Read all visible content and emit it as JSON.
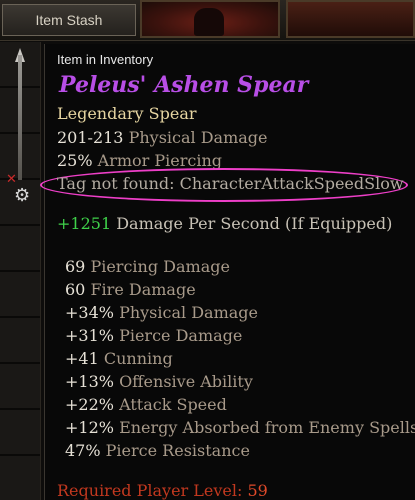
{
  "stash": {
    "tab_label": "Item Stash"
  },
  "tooltip": {
    "location": "Item in Inventory",
    "item_name": "Peleus' Ashen Spear",
    "item_type": "Legendary Spear",
    "base_stats": [
      {
        "value": "201-213",
        "label": "Physical Damage"
      },
      {
        "value": "25%",
        "label": "Armor Piercing"
      }
    ],
    "tag_error": "Tag not found: CharacterAttackSpeedSlow",
    "dps": {
      "value": "+1251",
      "label": "Damage Per Second (If Equipped)"
    },
    "mods": [
      {
        "value": "69",
        "label": "Piercing Damage"
      },
      {
        "value": "60",
        "label": "Fire Damage"
      },
      {
        "value": "+34%",
        "label": "Physical Damage"
      },
      {
        "value": "+31%",
        "label": "Pierce Damage"
      },
      {
        "value": "+41",
        "label": "Cunning"
      },
      {
        "value": "+13%",
        "label": "Offensive Ability"
      },
      {
        "value": "+22%",
        "label": "Attack Speed"
      },
      {
        "value": "+12%",
        "label": "Energy Absorbed from Enemy Spells"
      },
      {
        "value": "47%",
        "label": "Pierce Resistance"
      }
    ],
    "requirement": {
      "label": "Required Player Level:",
      "value": "59"
    }
  },
  "colors": {
    "legendary_name": "#b84ee6",
    "dps_value": "#3fd14a",
    "requirement": "#c2381f",
    "highlight_ring": "#ee3fc8"
  },
  "icons": [
    "spear-item-icon",
    "red-x-icon",
    "compare-gauntlet-icon"
  ]
}
